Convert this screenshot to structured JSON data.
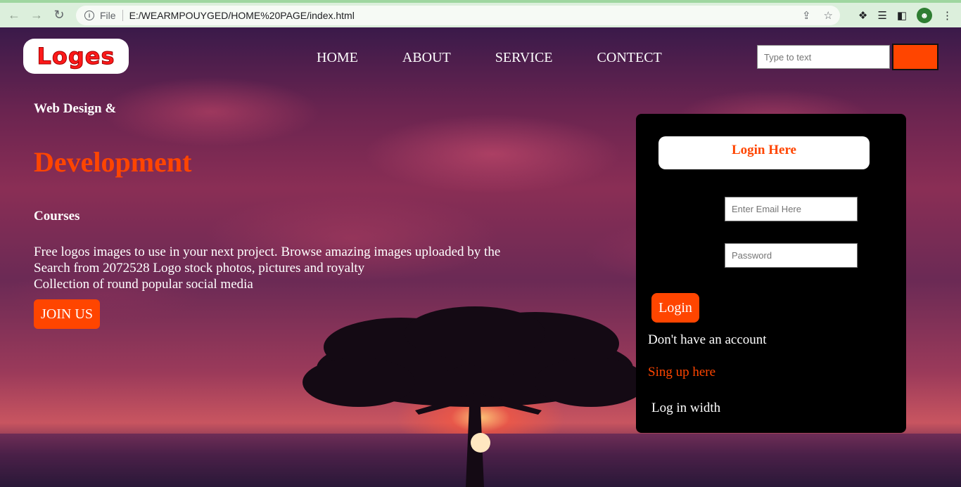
{
  "browser": {
    "file_label": "File",
    "url": "E:/WEARMPOUYGED/HOME%20PAGE/index.html"
  },
  "header": {
    "logo_text": "Loges",
    "nav": [
      "HOME",
      "ABOUT",
      "SERVICE",
      "CONTECT"
    ],
    "search_placeholder": "Type to text"
  },
  "hero": {
    "subtitle": "Web Design &",
    "title": "Development",
    "courses": "Courses",
    "paragraph_lines": [
      "Free logos images to use in your next project. Browse amazing images uploaded by the",
      "Search from 2072528 Logo stock photos, pictures and royalty",
      "Collection of round popular social media"
    ],
    "join_label": "JOIN US"
  },
  "login": {
    "title": "Login Here",
    "email_placeholder": "Enter Email Here",
    "password_placeholder": "Password",
    "button_label": "Login",
    "no_account": "Don't have an account",
    "signup_link": "Sing up here",
    "login_with": "Log in width"
  },
  "colors": {
    "accent": "#ff4500",
    "panel_bg": "#000000",
    "logo_red": "#ff1a1a"
  }
}
